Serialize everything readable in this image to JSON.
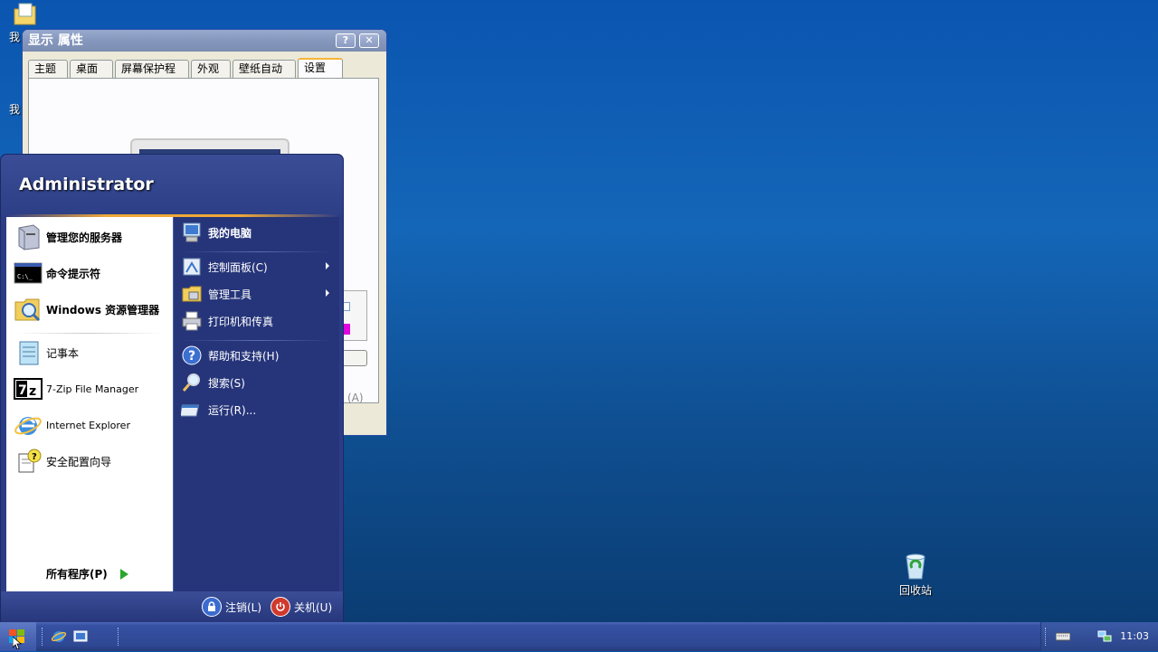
{
  "desktop": {
    "icons": [
      {
        "label": "我"
      },
      {
        "label": "我"
      },
      {
        "label": "回收站"
      }
    ]
  },
  "dialog": {
    "title": "显示 属性",
    "help_btn": "?",
    "close_btn": "✕",
    "tabs": [
      "主题",
      "桌面",
      "屏幕保护程序",
      "外观",
      "壁纸自动换",
      "设置"
    ],
    "active_tab": "设置",
    "apply_fragment": "(A)"
  },
  "start_menu": {
    "user": "Administrator",
    "left_items": [
      {
        "label": "管理您的服务器",
        "icon": "server-icon",
        "bold": true
      },
      {
        "label": "命令提示符",
        "icon": "cmd-icon",
        "bold": true
      },
      {
        "label": "Windows 资源管理器",
        "icon": "explorer-icon",
        "bold": true
      },
      {
        "label": "记事本",
        "icon": "notepad-icon",
        "bold": false
      },
      {
        "label": "7-Zip File Manager",
        "icon": "7zip-icon",
        "bold": false
      },
      {
        "label": "Internet Explorer",
        "icon": "ie-icon",
        "bold": false
      },
      {
        "label": "安全配置向导",
        "icon": "security-wizard-icon",
        "bold": false
      }
    ],
    "all_programs": "所有程序(P)",
    "right_items": [
      {
        "label": "我的电脑",
        "icon": "computer-icon",
        "bold": true
      },
      {
        "label": "控制面板(C)",
        "icon": "control-panel-icon",
        "submenu": true
      },
      {
        "label": "管理工具",
        "icon": "admin-tools-icon",
        "submenu": true
      },
      {
        "label": "打印机和传真",
        "icon": "printer-icon"
      },
      {
        "label": "帮助和支持(H)",
        "icon": "help-icon"
      },
      {
        "label": "搜索(S)",
        "icon": "search-icon"
      },
      {
        "label": "运行(R)...",
        "icon": "run-icon"
      }
    ],
    "logoff": "注销(L)",
    "shutdown": "关机(U)"
  },
  "taskbar": {
    "clock": "11:03"
  }
}
